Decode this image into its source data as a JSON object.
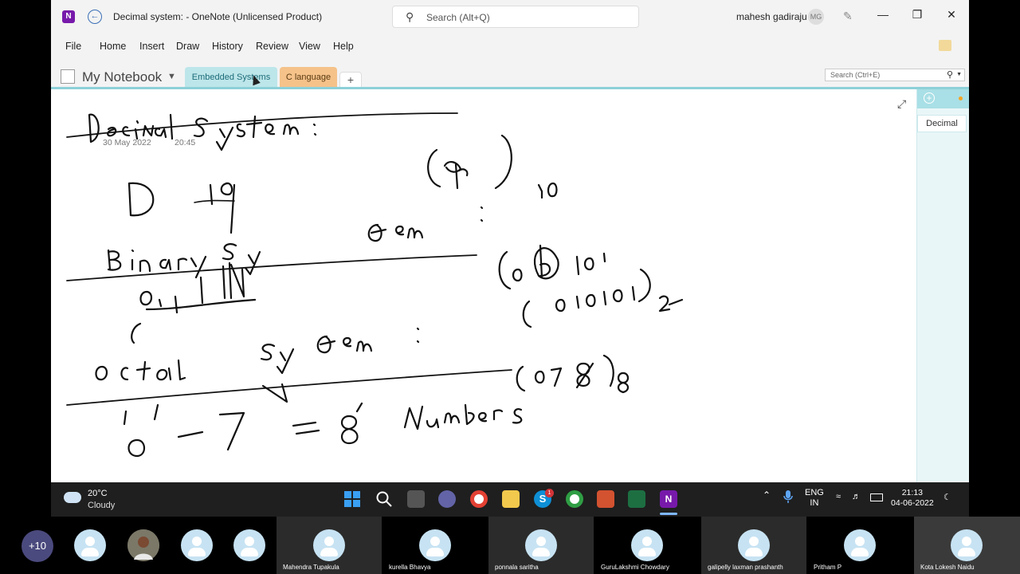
{
  "app": {
    "title": "Decimal system:  -  OneNote (Unlicensed Product)",
    "logo": "N",
    "search_placeholder": "Search (Alt+Q)",
    "user_name": "mahesh gadiraju",
    "user_initials": "MG"
  },
  "menu": [
    "File",
    "Home",
    "Insert",
    "Draw",
    "History",
    "Review",
    "View",
    "Help"
  ],
  "notebook": {
    "name": "My Notebook",
    "sections": [
      "Embedded Systems",
      "C language"
    ],
    "add_label": "+",
    "section_search_placeholder": "Search (Ctrl+E)"
  },
  "page": {
    "title": "Decimal system :",
    "date": "30 May 2022",
    "time": "20:45"
  },
  "pages_panel": {
    "add_label": "+",
    "pages": [
      "Decimal"
    ]
  },
  "taskbar": {
    "weather_temp": "20°C",
    "weather_cond": "Cloudy",
    "skype_badge": "1",
    "lang_top": "ENG",
    "lang_bottom": "IN",
    "clock_time": "21:13",
    "clock_date": "04-06-2022"
  },
  "meeting": {
    "more_count": "+10",
    "participants": [
      "Mahendra Tupakula",
      "kurella Bhavya",
      "ponnala saritha",
      "GuruLakshmi Chowdary",
      "galipelly laxman prashanth",
      "Pritham P",
      "Kota Lokesh Naidu"
    ]
  }
}
